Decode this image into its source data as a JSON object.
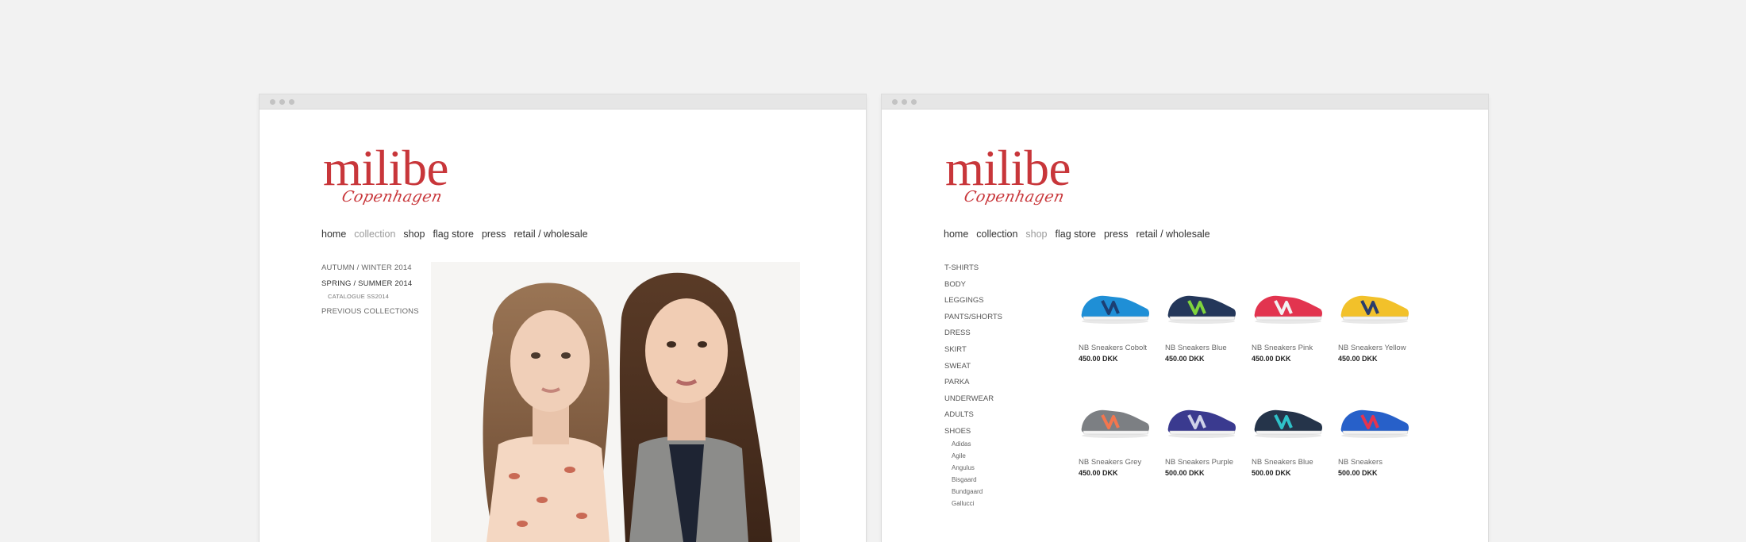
{
  "logo": {
    "wordmark": "milibe",
    "script": "Copenhagen"
  },
  "left_window": {
    "nav": [
      "home",
      "collection",
      "shop",
      "flag store",
      "press",
      "retail / wholesale"
    ],
    "active_nav": "collection",
    "sidebar": {
      "autumn": "AUTUMN / WINTER 2014",
      "spring": "SPRING / SUMMER 2014",
      "catalogue": "CATALOGUE SS2014",
      "previous": "PREVIOUS COLLECTIONS"
    }
  },
  "right_window": {
    "nav": [
      "home",
      "collection",
      "shop",
      "flag store",
      "press",
      "retail / wholesale"
    ],
    "active_nav": "shop",
    "categories": [
      "T-SHIRTS",
      "BODY",
      "LEGGINGS",
      "PANTS/SHORTS",
      "DRESS",
      "SKIRT",
      "SWEAT",
      "PARKA",
      "UNDERWEAR",
      "ADULTS",
      "SHOES"
    ],
    "shoe_brands": [
      "Adidas",
      "Agile",
      "Angulus",
      "Bisgaard",
      "Bundgaard",
      "Gallucci"
    ],
    "products": [
      {
        "name": "NB Sneakers Cobolt",
        "price": "450.00 DKK",
        "color": "#1f8fd6",
        "accent": "#1c3f73"
      },
      {
        "name": "NB Sneakers Blue",
        "price": "450.00 DKK",
        "color": "#24375a",
        "accent": "#7fd43d"
      },
      {
        "name": "NB Sneakers Pink",
        "price": "450.00 DKK",
        "color": "#e2344f",
        "accent": "#f2f2f2"
      },
      {
        "name": "NB Sneakers Yellow",
        "price": "450.00 DKK",
        "color": "#f2c12a",
        "accent": "#2a3d6b"
      },
      {
        "name": "NB Sneakers Grey",
        "price": "450.00 DKK",
        "color": "#7c7f83",
        "accent": "#f3764e"
      },
      {
        "name": "NB Sneakers Purple",
        "price": "500.00 DKK",
        "color": "#3a3a8f",
        "accent": "#cfd2e8"
      },
      {
        "name": "NB Sneakers Blue",
        "price": "500.00 DKK",
        "color": "#25344a",
        "accent": "#2fc1c8"
      },
      {
        "name": "NB Sneakers",
        "price": "500.00 DKK",
        "color": "#2760c9",
        "accent": "#e5344e"
      }
    ]
  },
  "colors": {
    "brand_red": "#c8363a",
    "background": "#f2f2f2"
  }
}
